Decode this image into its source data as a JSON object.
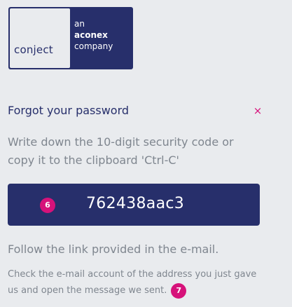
{
  "logo": {
    "conject": "conject",
    "an": "an",
    "aconex": "aconex",
    "company": "company"
  },
  "dialog": {
    "title": "Forgot your password",
    "close_icon": "×",
    "instruction": "Write down the 10-digit security code or copy it to the clipboard 'Ctrl-C'",
    "code_badge": "6",
    "security_code": "762438aac3",
    "follow_text": "Follow the link provided in the e-mail.",
    "check_text": "Check the e-mail account of the address you just gave us and open the message we sent.",
    "check_badge": "7"
  },
  "colors": {
    "brand_navy": "#272f6b",
    "accent_pink": "#d6127a",
    "muted_text": "#7f868f",
    "background": "#e9ebee"
  }
}
